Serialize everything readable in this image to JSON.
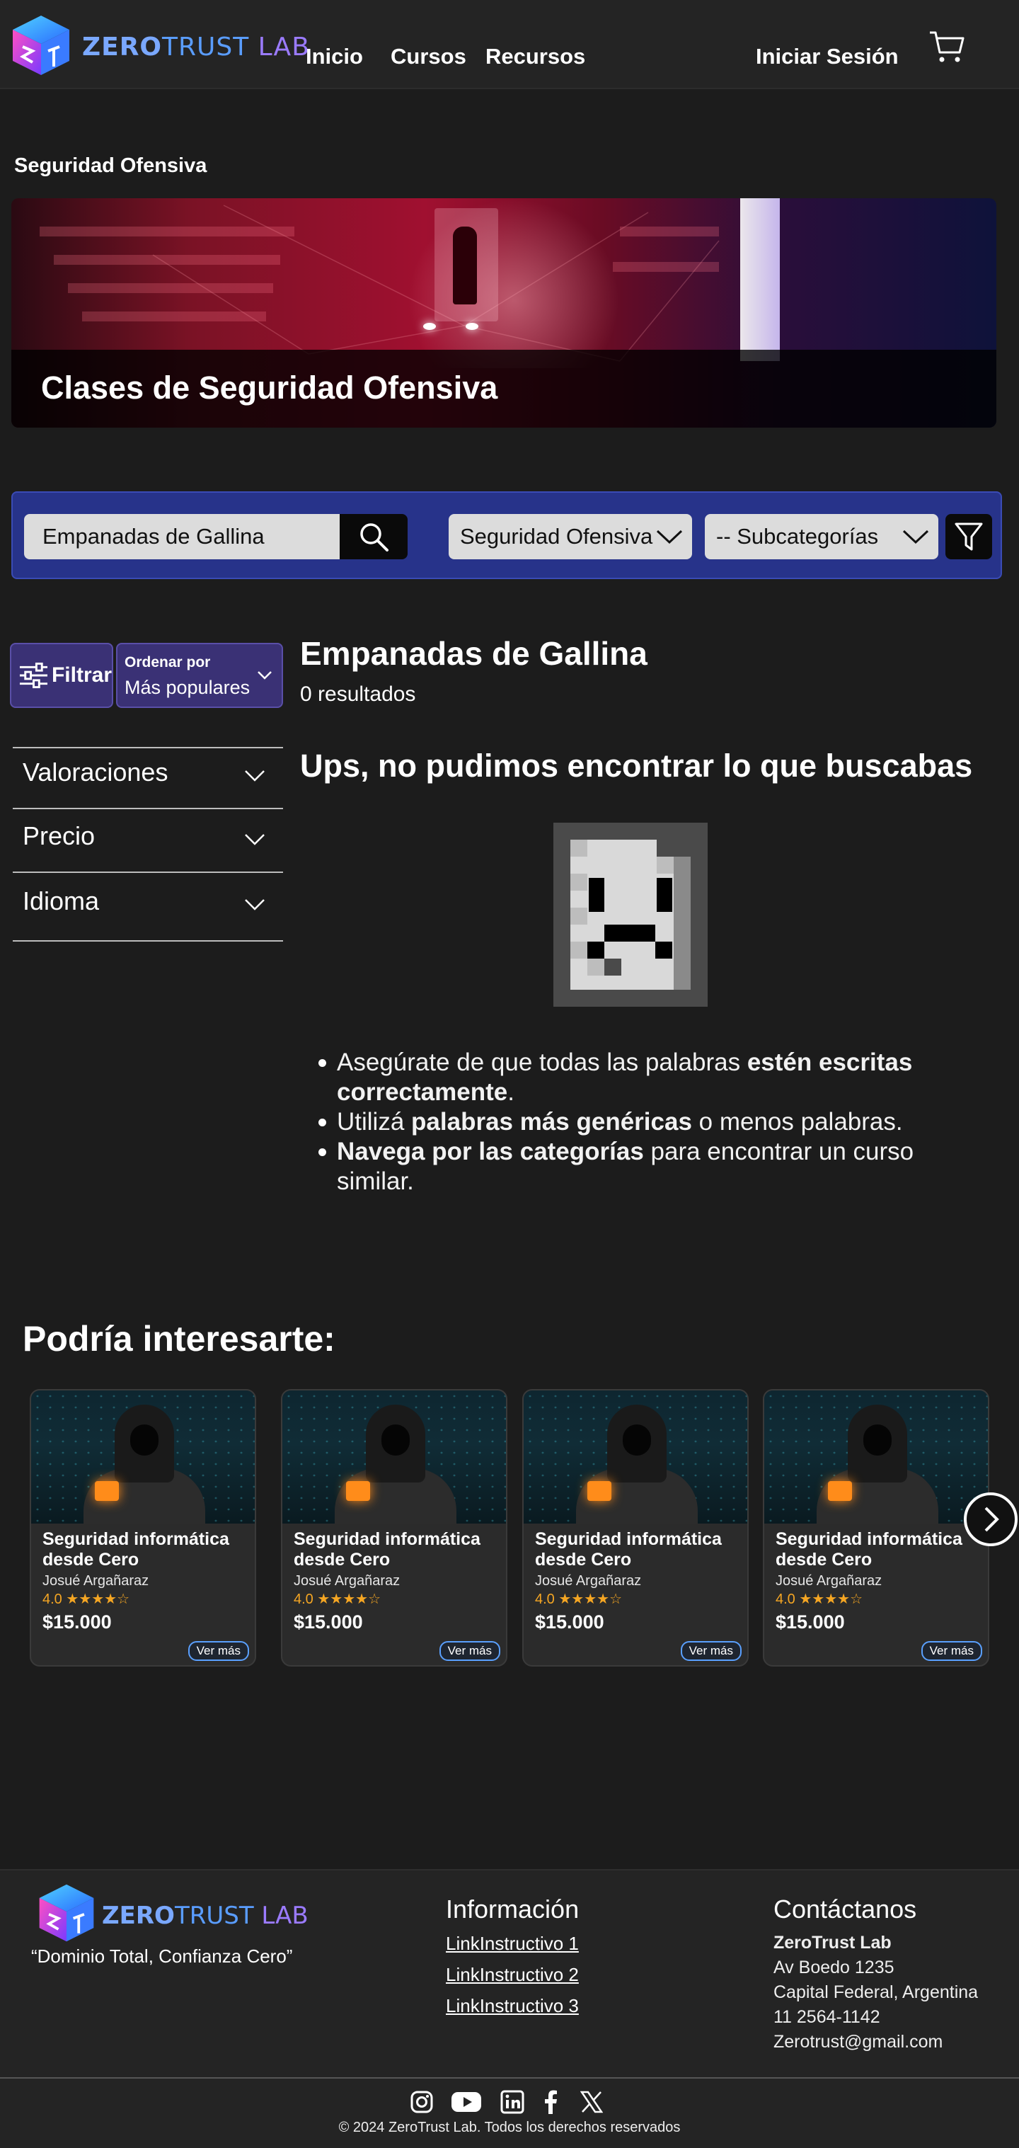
{
  "header": {
    "logo_text_a": "ZERO",
    "logo_text_b": "TRUST",
    "logo_text_c": " LAB",
    "nav": [
      "Inicio",
      "Cursos",
      "Recursos"
    ],
    "login": "Iniciar Sesión",
    "cart_icon": "cart-icon"
  },
  "breadcrumb": "Seguridad Ofensiva",
  "hero": {
    "title": "Clases de Seguridad Ofensiva"
  },
  "search": {
    "query": "Empanadas de Gallina",
    "category": "Seguridad Ofensiva",
    "subcategory": "-- Subcategorías"
  },
  "sidebar": {
    "filter_label": "Filtrar",
    "sort_label": "Ordenar por",
    "sort_value": "Más populares",
    "accordions": [
      "Valoraciones",
      "Precio",
      "Idioma"
    ]
  },
  "results": {
    "title": "Empanadas de Gallina",
    "count": "0 resultados",
    "empty_title": "Ups, no pudimos encontrar lo que buscabas",
    "tips": [
      {
        "pre": "Asegúrate de que todas las palabras ",
        "bold": "estén escritas correctamente",
        "post": "."
      },
      {
        "pre": "Utilizá ",
        "bold": "palabras más genéricas",
        "post": " o menos palabras."
      },
      {
        "pre": "",
        "bold": "Navega por las categorías",
        "post": " para encontrar un curso similar."
      }
    ]
  },
  "recommendations": {
    "title": "Podría interesarte:",
    "cards": [
      {
        "title": "Seguridad informática desde Cero",
        "author": "Josué Argañaraz",
        "rating": "4.0",
        "stars": "★★★★☆",
        "price": "$15.000",
        "cta": "Ver más"
      },
      {
        "title": "Seguridad informática desde Cero",
        "author": "Josué Argañaraz",
        "rating": "4.0",
        "stars": "★★★★☆",
        "price": "$15.000",
        "cta": "Ver más"
      },
      {
        "title": "Seguridad informática desde Cero",
        "author": "Josué Argañaraz",
        "rating": "4.0",
        "stars": "★★★★☆",
        "price": "$15.000",
        "cta": "Ver más"
      },
      {
        "title": "Seguridad informática desde Cero",
        "author": "Josué Argañaraz",
        "rating": "4.0",
        "stars": "★★★★☆",
        "price": "$15.000",
        "cta": "Ver más"
      }
    ]
  },
  "footer": {
    "slogan": "“Dominio Total, Confianza Cero”",
    "info_title": "Información",
    "links": [
      "LinkInstructivo 1",
      "LinkInstructivo 2",
      "LinkInstructivo 3"
    ],
    "contact_title": "Contáctanos",
    "contact": [
      "ZeroTrust Lab",
      "Av Boedo 1235",
      "Capital Federal, Argentina",
      "11 2564-1142",
      "Zerotrust@gmail.com"
    ],
    "social": [
      "instagram-icon",
      "youtube-icon",
      "linkedin-icon",
      "facebook-icon",
      "x-icon"
    ],
    "copyright": "© 2024 ZeroTrust Lab. Todos los derechos reservados"
  },
  "colors": {
    "background": "#1c1c1c",
    "header": "#242424",
    "searchbar": "#27338a",
    "sidebar_button": "#3a3175",
    "star": "#f5a623",
    "link_accent": "#5aa0ff"
  }
}
